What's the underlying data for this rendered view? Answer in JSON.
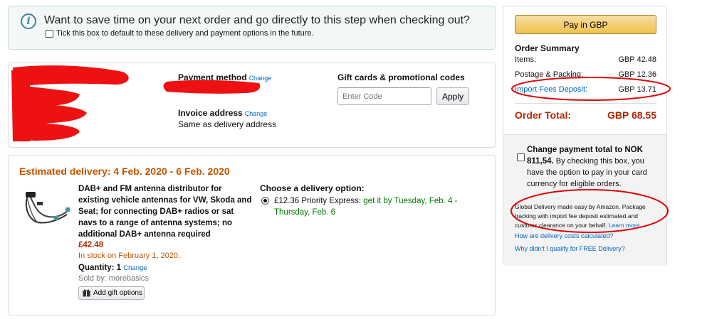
{
  "banner": {
    "headline": "Want to save time on your next order and go directly to this step when checking out?",
    "checkbox_label": "Tick this box to default to these delivery and payment options in the future.",
    "icon": "info-icon"
  },
  "payment": {
    "method_label": "Payment method",
    "method_change": "Change",
    "invoice_label": "Invoice address",
    "invoice_change": "Change",
    "invoice_value": "Same as delivery address",
    "gift_label": "Gift cards & promotional codes",
    "code_placeholder": "Enter Code",
    "apply_label": "Apply"
  },
  "delivery": {
    "estimated": "Estimated delivery:  4 Feb. 2020 - 6 Feb. 2020",
    "product_title": "DAB+ and FM antenna distributor for existing vehicle antennas for VW, Skoda and Seat; for connecting DAB+ radios or sat navs to a range of antenna systems; no additional DAB+ antenna required",
    "price": "£42.48",
    "stock": "In stock on February 1, 2020.",
    "quantity_label": "Quantity: 1",
    "quantity_change": "Change",
    "sold_by": "Sold by: morebasics",
    "gift_button": "Add gift options",
    "choose_label": "Choose a delivery option:",
    "option_price": "£12.36 Priority Express",
    "option_eta": ": get it by Tuesday, Feb. 4 - Thursday, Feb. 6"
  },
  "summary": {
    "pay_button": "Pay in GBP",
    "title": "Order Summary",
    "rows": [
      {
        "label": "Items:",
        "value": "GBP 42.48"
      },
      {
        "label": "Postage & Packing:",
        "value": "GBP 12.36"
      },
      {
        "label": "Import Fees Deposit:",
        "value": "GBP 13.71"
      }
    ],
    "total_label": "Order Total:",
    "total_value": "GBP 68.55",
    "nok_bold": "Change payment total to NOK 811,54.",
    "nok_text": " By checking this box, you have the option to pay in your card currency for eligible orders.",
    "global_text": "Global Delivery made easy by Amazon. Package tracking with import fee deposit estimated and customs clearance on your behalf. ",
    "learn_more": "Learn more",
    "faq1": "How are delivery costs calculated?",
    "faq2": "Why didn't I qualify for FREE Delivery?"
  },
  "colors": {
    "accent_orange": "#c45500",
    "price_red": "#b12704",
    "link_blue": "#0066c0",
    "green": "#007600",
    "annotation_red": "#e00000"
  }
}
